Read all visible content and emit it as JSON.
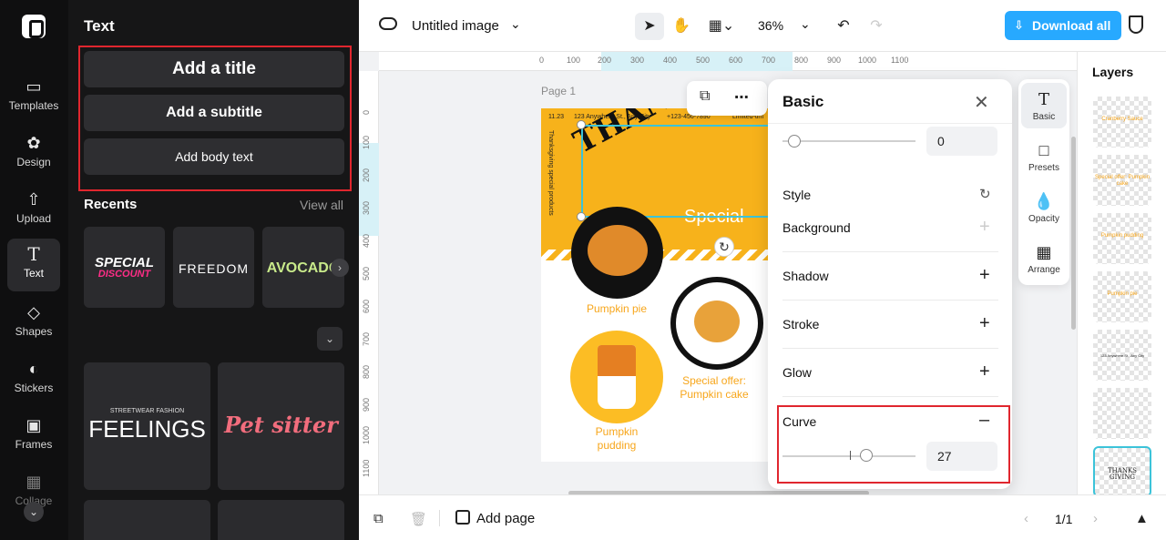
{
  "rail": {
    "items": [
      {
        "label": "Templates",
        "icon": "templates-icon"
      },
      {
        "label": "Design",
        "icon": "design-icon"
      },
      {
        "label": "Upload",
        "icon": "upload-icon"
      },
      {
        "label": "Text",
        "icon": "text-icon"
      },
      {
        "label": "Shapes",
        "icon": "shapes-icon"
      },
      {
        "label": "Stickers",
        "icon": "stickers-icon"
      },
      {
        "label": "Frames",
        "icon": "frames-icon"
      },
      {
        "label": "Collage",
        "icon": "collage-icon"
      }
    ]
  },
  "panel": {
    "title": "Text",
    "add_title": "Add a title",
    "add_subtitle": "Add a subtitle",
    "add_body": "Add body text",
    "recents_label": "Recents",
    "view_all": "View all",
    "recents": [
      "SPECIAL",
      "DISCOUNT",
      "FREEDOM",
      "AVOCADO"
    ],
    "templates": [
      "STREETWEAR FASHION",
      "FEELINGS",
      "Pet sitter"
    ]
  },
  "topbar": {
    "doc_title": "Untitled image",
    "zoom": "36%",
    "download_label": "Download all"
  },
  "canvas": {
    "page_label": "Page 1",
    "ruler_top": [
      "0",
      "100",
      "200",
      "300",
      "400",
      "500",
      "600",
      "700",
      "800",
      "900",
      "1000",
      "1100"
    ],
    "ruler_left": [
      "0",
      "100",
      "200",
      "300",
      "400",
      "500",
      "600",
      "700",
      "800",
      "900",
      "1000",
      "1100"
    ],
    "header_left": "11.23",
    "header_address": "123 Anywhere St., Any City",
    "header_phone": "+123-456-7890",
    "header_right": "Limited-tim",
    "vertical_text": "Thanksgiving special products",
    "curved_title": "THANKS GI",
    "special_word": "Special",
    "item1": "Pumpkin pie",
    "item2_line1": "Special offer:",
    "item2_line2": "Pumpkin cake",
    "item3_line1": "Pumpkin",
    "item3_line2": "pudding"
  },
  "props": {
    "title": "Basic",
    "top_value": "0",
    "style_label": "Style",
    "background_label": "Background",
    "shadow_label": "Shadow",
    "stroke_label": "Stroke",
    "glow_label": "Glow",
    "curve_label": "Curve",
    "curve_value": "27",
    "top_slider_fraction": 0.09,
    "curve_slider_fraction": 0.63
  },
  "side_tabs": [
    {
      "label": "Basic",
      "icon": "text-T-icon"
    },
    {
      "label": "Presets",
      "icon": "presets-icon"
    },
    {
      "label": "Opacity",
      "icon": "opacity-drop-icon"
    },
    {
      "label": "Arrange",
      "icon": "arrange-icon"
    }
  ],
  "layers": {
    "title": "Layers",
    "items": [
      "Cranberry Sauce",
      "Special offer: Pumpkin cake",
      "Pumpkin pudding",
      "Pumpkin pie",
      "123 Anywhere St., Any City",
      "",
      "THANKS GIVING"
    ]
  },
  "bottombar": {
    "add_page": "Add page",
    "pager": "1/1"
  },
  "colors": {
    "accent": "#27a9ff",
    "selection": "#3cc3d9",
    "highlight_red": "#e0262e",
    "brand_orange": "#f7b21b"
  }
}
